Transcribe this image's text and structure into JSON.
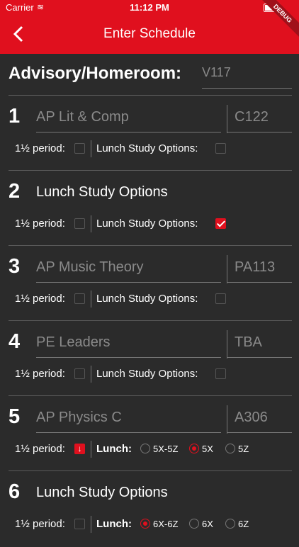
{
  "status": {
    "carrier": "Carrier",
    "time": "11:12 PM"
  },
  "nav": {
    "title": "Enter Schedule",
    "debug": "DEBUG"
  },
  "advisory": {
    "label": "Advisory/Homeroom:",
    "value": "V117"
  },
  "labels": {
    "half_period": "1½ period:",
    "lunch_study": "Lunch Study Options:",
    "lunch": "Lunch:"
  },
  "periods": [
    {
      "num": "1",
      "name": "AP Lit & Comp",
      "room": "C122",
      "half": false,
      "lso": false
    },
    {
      "num": "2",
      "name": "Lunch Study Options",
      "room": "",
      "half": false,
      "lso": true
    },
    {
      "num": "3",
      "name": "AP Music Theory",
      "room": "PA113",
      "half": false,
      "lso": false
    },
    {
      "num": "4",
      "name": "PE Leaders",
      "room": "TBA",
      "half": false,
      "lso": false
    },
    {
      "num": "5",
      "name": "AP Physics C",
      "room": "A306",
      "half": true,
      "lunch_options": [
        "5X-5Z",
        "5X",
        "5Z"
      ],
      "lunch_selected": "5X"
    },
    {
      "num": "6",
      "name": "Lunch Study Options",
      "room": "",
      "half": false,
      "lunch_options": [
        "6X-6Z",
        "6X",
        "6Z"
      ],
      "lunch_selected": "6X-6Z"
    }
  ]
}
